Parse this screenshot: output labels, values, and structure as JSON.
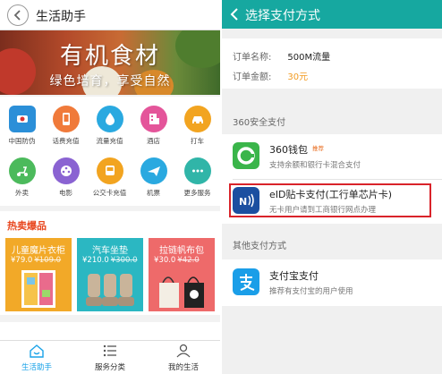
{
  "left": {
    "header": {
      "title": "生活助手"
    },
    "banner": {
      "title": "有机食材",
      "subtitle": "绿色培育，享受自然"
    },
    "services": [
      {
        "label": "中国防伪",
        "icon": "shield-icon",
        "color": "#2b8fd8"
      },
      {
        "label": "话费充值",
        "icon": "phone-icon",
        "color": "#f07a3a"
      },
      {
        "label": "流量充值",
        "icon": "droplet-icon",
        "color": "#2aa9e0"
      },
      {
        "label": "酒店",
        "icon": "hotel-icon",
        "color": "#e4559a"
      },
      {
        "label": "打车",
        "icon": "taxi-icon",
        "color": "#f2a420"
      },
      {
        "label": "外卖",
        "icon": "scooter-icon",
        "color": "#4cba5c"
      },
      {
        "label": "电影",
        "icon": "film-icon",
        "color": "#8a63d2"
      },
      {
        "label": "公交卡充值",
        "icon": "bus-icon",
        "color": "#f2a420"
      },
      {
        "label": "机票",
        "icon": "plane-icon",
        "color": "#2aa9e0"
      },
      {
        "label": "更多服务",
        "icon": "more-icon",
        "color": "#30b5a8"
      }
    ],
    "hot": {
      "title": "热卖爆品",
      "cards": [
        {
          "name": "儿童魔片衣柜",
          "price": "¥79.0",
          "old_price": "¥109.0",
          "color": "#f2a928"
        },
        {
          "name": "汽车坐垫",
          "price": "¥210.0",
          "old_price": "¥300.0",
          "color": "#2bb7c2"
        },
        {
          "name": "拉链帆布包",
          "price": "¥30.0",
          "old_price": "¥42.0",
          "color": "#ee6a6a"
        }
      ]
    },
    "tabbar": [
      {
        "label": "生活助手",
        "icon": "home-icon"
      },
      {
        "label": "服务分类",
        "icon": "list-icon"
      },
      {
        "label": "我的生活",
        "icon": "user-icon"
      }
    ],
    "active_color": "#1aa3e8"
  },
  "right": {
    "header": {
      "title": "选择支付方式"
    },
    "accent": "#16a8a0",
    "order": {
      "name_label": "订单名称:",
      "name_value": "500M流量",
      "amount_label": "订单金额:",
      "amount_value": "30元"
    },
    "section1": "360安全支付",
    "methods": [
      {
        "name": "360钱包",
        "tag": "推荐",
        "desc": "支持余额和银行卡混合支付",
        "icon": "wallet-360-icon"
      },
      {
        "name": "eID贴卡支付(工行单芯片卡)",
        "tag": "",
        "desc": "无卡用户请到工商银行网点办理",
        "icon": "nfc-icon"
      }
    ],
    "section2": "其他支付方式",
    "others": [
      {
        "name": "支付宝支付",
        "desc": "推荐有支付宝的用户使用",
        "icon": "alipay-icon"
      }
    ]
  }
}
